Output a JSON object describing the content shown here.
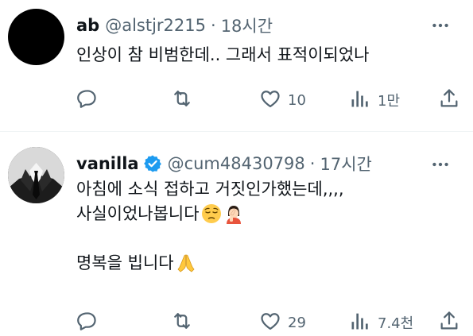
{
  "tweets": [
    {
      "name": "ab",
      "handle": "@alstjr2215",
      "separator": "·",
      "time": "18시간",
      "text": "인상이 참 비범한데.. 그래서 표적이되었나",
      "likes": "10",
      "views": "1만"
    },
    {
      "name": "vanilla",
      "handle": "@cum48430798",
      "separator": "·",
      "time": "17시간",
      "line1": "아침에 소식 접하고 거짓인가했는데,,,,",
      "line2": "사실이었나봅니다",
      "line3": "명복을 빕니다",
      "likes": "29",
      "views": "7.4천"
    }
  ],
  "icons": {
    "reply": "reply-icon",
    "retweet": "retweet-icon",
    "like": "like-icon",
    "views": "views-icon",
    "share": "share-icon",
    "more": "more-icon",
    "verified": "verified-badge-icon"
  },
  "colors": {
    "text": "#0f1419",
    "muted": "#536471",
    "verified": "#1d9bf0",
    "divider": "#eff3f4"
  }
}
